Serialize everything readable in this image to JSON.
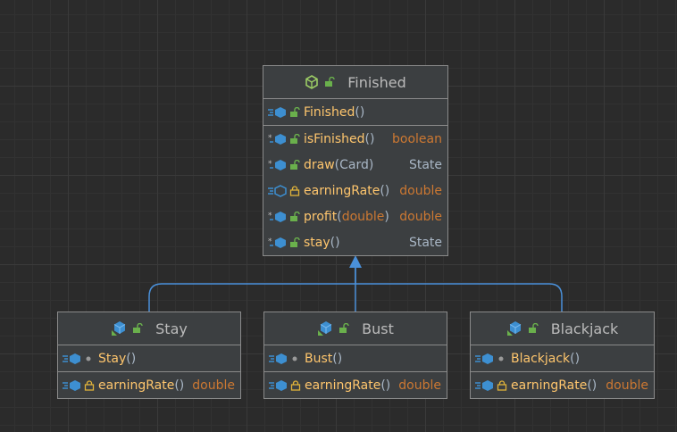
{
  "classes": {
    "finished": {
      "title": "Finished",
      "constructor": {
        "name": "Finished",
        "params": ""
      },
      "methods": [
        {
          "name": "isFinished",
          "open": "(",
          "params": "",
          "close": ")",
          "ret": "boolean",
          "ret_kind": "keyword"
        },
        {
          "name": "draw",
          "open": "(",
          "params": "Card",
          "close": ")",
          "ret": "State",
          "ret_kind": "type"
        },
        {
          "name": "earningRate",
          "open": "(",
          "params": "",
          "close": ")",
          "ret": "double",
          "ret_kind": "keyword"
        },
        {
          "name": "profit",
          "open": "(",
          "params": "double",
          "close": ")",
          "ret": "double",
          "ret_kind": "keyword"
        },
        {
          "name": "stay",
          "open": "(",
          "params": "",
          "close": ")",
          "ret": "State",
          "ret_kind": "type"
        }
      ]
    },
    "stay": {
      "title": "Stay",
      "constructor": {
        "name": "Stay",
        "params": ""
      },
      "method": {
        "name": "earningRate",
        "open": "(",
        "params": "",
        "close": ")",
        "ret": "double"
      }
    },
    "bust": {
      "title": "Bust",
      "constructor": {
        "name": "Bust",
        "params": ""
      },
      "method": {
        "name": "earningRate",
        "open": "(",
        "params": "",
        "close": ")",
        "ret": "double"
      }
    },
    "blackjack": {
      "title": "Blackjack",
      "constructor": {
        "name": "Blackjack",
        "params": ""
      },
      "method": {
        "name": "earningRate",
        "open": "(",
        "params": "",
        "close": ")",
        "ret": "double"
      }
    }
  },
  "colors": {
    "background": "#2b2b2b",
    "box": "#3c3f41",
    "border": "#8a8a8a",
    "method_name": "#ffc66d",
    "keyword": "#cc7832",
    "text": "#bbbbbb",
    "arrow": "#4a90d9",
    "icon_blue": "#3d8fd1",
    "icon_green": "#6ab04c",
    "icon_yellow": "#e0b23a"
  },
  "icons": {
    "abstract_class": "abstract-class-icon",
    "class": "class-icon",
    "method": "method-icon",
    "abstract_method": "abstract-method-icon",
    "public": "unlocked-icon",
    "private": "locked-icon",
    "package_private": "dot-icon"
  }
}
